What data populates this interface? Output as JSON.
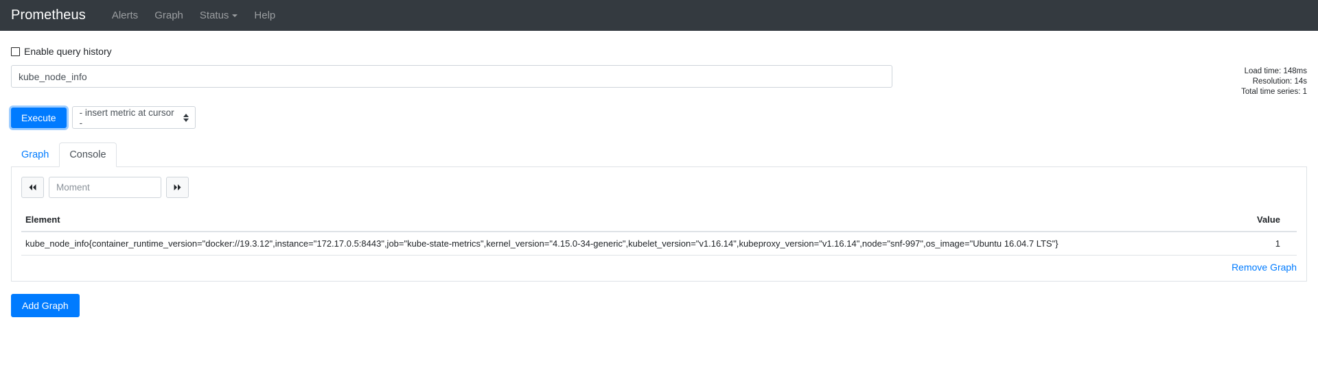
{
  "navbar": {
    "brand": "Prometheus",
    "links": [
      {
        "label": "Alerts"
      },
      {
        "label": "Graph"
      },
      {
        "label": "Status"
      },
      {
        "label": "Help"
      }
    ]
  },
  "query": {
    "history_label": "Enable query history",
    "expression": "kube_node_info",
    "execute_label": "Execute",
    "metric_select_value": "- insert metric at cursor -"
  },
  "stats": {
    "load_time": "Load time: 148ms",
    "resolution": "Resolution: 14s",
    "total_series": "Total time series: 1"
  },
  "tabs": [
    {
      "label": "Graph",
      "active": false
    },
    {
      "label": "Console",
      "active": true
    }
  ],
  "time_nav": {
    "back_icon": "double-chevron-left-icon",
    "forward_icon": "double-chevron-right-icon",
    "moment_placeholder": "Moment",
    "moment_value": ""
  },
  "table": {
    "headers": {
      "element": "Element",
      "value": "Value"
    },
    "rows": [
      {
        "element": "kube_node_info{container_runtime_version=\"docker://19.3.12\",instance=\"172.17.0.5:8443\",job=\"kube-state-metrics\",kernel_version=\"4.15.0-34-generic\",kubelet_version=\"v1.16.14\",kubeproxy_version=\"v1.16.14\",node=\"snf-997\",os_image=\"Ubuntu 16.04.7 LTS\"}",
        "value": "1"
      }
    ]
  },
  "actions": {
    "remove_graph": "Remove Graph",
    "add_graph": "Add Graph"
  },
  "colors": {
    "navbar_bg": "#343a40",
    "primary": "#007bff",
    "border": "#dee2e6"
  }
}
